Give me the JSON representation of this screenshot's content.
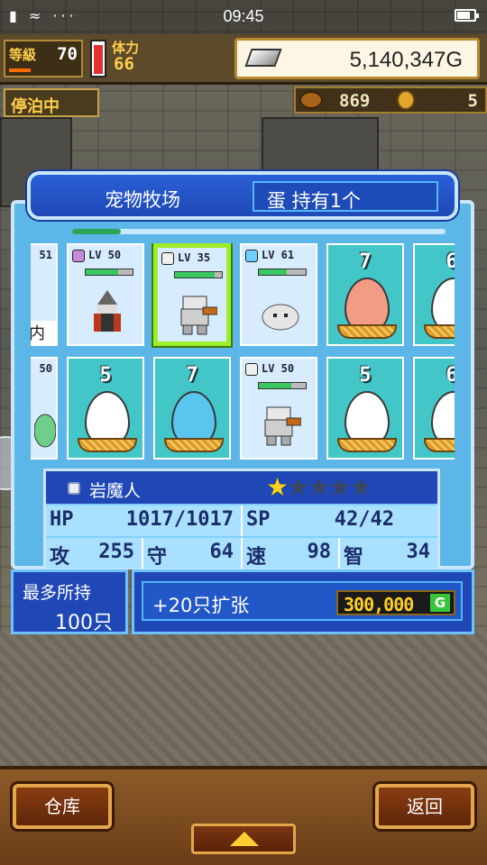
{
  "status_bar": {
    "time": "09:45",
    "left_icons": "▮ ≈ ···"
  },
  "hud": {
    "level_label": "等級",
    "level_value": "70",
    "stamina_label": "体力",
    "stamina_value": "66",
    "gold": "5,140,347G",
    "dock_status": "停泊中",
    "resource_a": "869",
    "resource_b": "5"
  },
  "panel": {
    "title": "宠物牧场",
    "eggs_held": "蛋 持有1个"
  },
  "grid": {
    "row1": [
      {
        "kind": "pet-partial",
        "lv": "51"
      },
      {
        "kind": "pet",
        "lv": "LV 50"
      },
      {
        "kind": "pet",
        "lv": "LV 35",
        "selected": true
      },
      {
        "kind": "pet",
        "lv": "LV 61"
      },
      {
        "kind": "egg",
        "num": "7",
        "color": "#f39c84"
      },
      {
        "kind": "egg",
        "num": "6",
        "color": "#ffffff"
      }
    ],
    "row2": [
      {
        "kind": "pet-partial",
        "lv": "50"
      },
      {
        "kind": "egg",
        "num": "5",
        "color": "#ffffff"
      },
      {
        "kind": "egg",
        "num": "7",
        "color": "#58c6ef"
      },
      {
        "kind": "pet",
        "lv": "LV 50"
      },
      {
        "kind": "egg",
        "num": "5",
        "color": "#ffffff"
      },
      {
        "kind": "egg",
        "num": "6",
        "color": "#ffffff"
      }
    ],
    "cut_label": "内"
  },
  "selected_pet": {
    "name": "岩魔人",
    "stars_filled": 1,
    "stars_total": 5,
    "hp_label": "HP",
    "hp_value": "1017/1017",
    "sp_label": "SP",
    "sp_value": "42/42",
    "atk_label": "攻",
    "atk_value": "255",
    "def_label": "守",
    "def_value": "64",
    "spd_label": "速",
    "spd_value": "98",
    "int_label": "智",
    "int_value": "34"
  },
  "capacity": {
    "label": "最多所持",
    "value": "100只"
  },
  "expand": {
    "label": "+20只扩张",
    "price": "300,000",
    "price_unit": "G"
  },
  "bottom": {
    "warehouse": "仓库",
    "back": "返回"
  },
  "colors": {
    "panel_blue": "#5db6e8",
    "header_blue": "#1f48b6",
    "selected_border": "#9ded2a",
    "star_on": "#ffd21a"
  }
}
